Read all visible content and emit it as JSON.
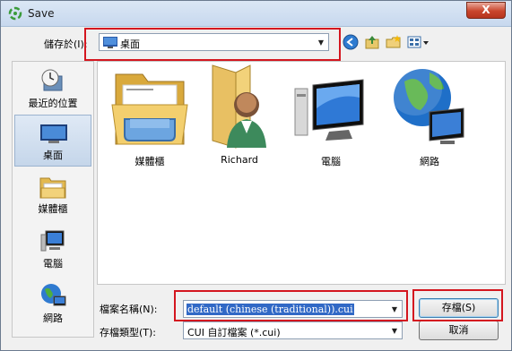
{
  "window": {
    "title": "Save",
    "close_label": "X"
  },
  "toolbar": {
    "save_in_label": "儲存於(I):",
    "location": "桌面",
    "icons": [
      "back-icon",
      "up-folder-icon",
      "new-folder-icon",
      "views-icon"
    ]
  },
  "places": [
    {
      "label": "最近的位置",
      "icon": "recent-places-icon"
    },
    {
      "label": "桌面",
      "icon": "desktop-icon",
      "selected": true
    },
    {
      "label": "媒體櫃",
      "icon": "libraries-icon"
    },
    {
      "label": "電腦",
      "icon": "computer-icon"
    },
    {
      "label": "網路",
      "icon": "network-icon"
    }
  ],
  "files": [
    {
      "label": "媒體櫃",
      "icon": "libraries-folder-icon"
    },
    {
      "label": "Richard",
      "icon": "user-folder-icon"
    },
    {
      "label": "電腦",
      "icon": "computer-icon"
    },
    {
      "label": "網路",
      "icon": "network-globe-icon"
    }
  ],
  "form": {
    "filename_label": "檔案名稱(N):",
    "filename_value": "default (chinese (traditional)).cui",
    "filetype_label": "存檔類型(T):",
    "filetype_value": "CUI 自訂檔案 (*.cui)"
  },
  "buttons": {
    "save": "存檔(S)",
    "cancel": "取消"
  },
  "colors": {
    "highlight_box": "#d4161f",
    "selection": "#3169c6"
  }
}
